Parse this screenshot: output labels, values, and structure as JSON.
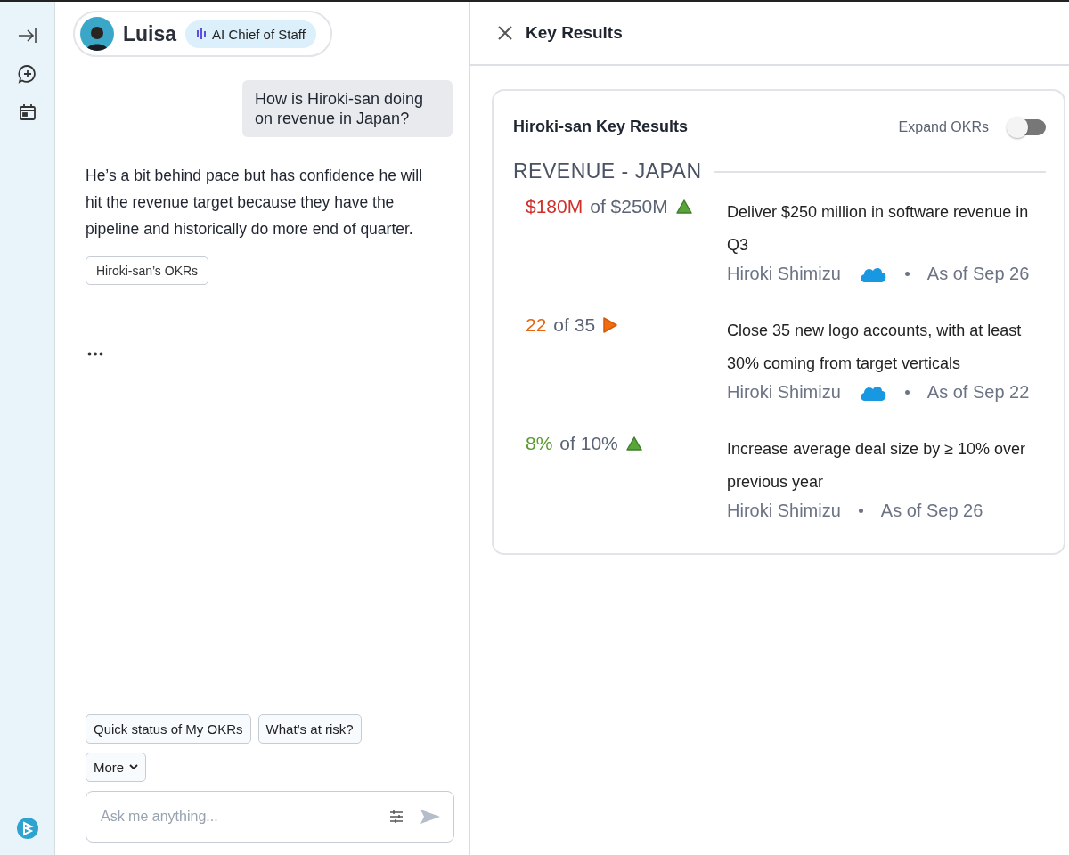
{
  "chat": {
    "agent": {
      "name": "Luisa",
      "badge": "AI Chief of Staff"
    },
    "messages": [
      {
        "kind": "user",
        "text": "How is Hiroki-san doing on revenue in Japan?"
      },
      {
        "kind": "assistant",
        "text": "He’s a bit behind pace but has confidence he will hit the revenue target because they have the pipeline and historically do more end of quarter.",
        "chips": [
          "Hiroki-san’s OKRs"
        ]
      },
      {
        "kind": "typing"
      }
    ],
    "suggestions": [
      "Quick status of My OKRs",
      "What’s at risk?"
    ],
    "more": "More",
    "input": {
      "placeholder": "Ask me anything..."
    }
  },
  "panel": {
    "title": "Key Results",
    "card": {
      "title": "Hiroki-san Key Results",
      "toggle": {
        "label": "Expand OKRs",
        "on": false
      },
      "section": "REVENUE - JAPAN",
      "results": [
        {
          "current": "$180M",
          "target": "of $250M",
          "color": "#d0302b",
          "kind": "up",
          "description": "Deliver $250 million in software revenue in Q3",
          "owner": "Hiroki Shimizu",
          "source_logo": true,
          "date": "As of Sep 26"
        },
        {
          "current": "22",
          "target": "of 35",
          "color": "#e8650f",
          "kind": "flat",
          "description": "Close 35 new logo accounts, with at least 30% coming from target verticals",
          "owner": "Hiroki Shimizu",
          "source_logo": true,
          "date": "As of Sep 22"
        },
        {
          "current": "8%",
          "target": "of 10%",
          "color": "#5a9a2e",
          "kind": "up",
          "description": "Increase average deal size by ≥ 10% over previous year",
          "owner": "Hiroki Shimizu",
          "source_logo": false,
          "date": "As of Sep 26"
        }
      ]
    }
  }
}
